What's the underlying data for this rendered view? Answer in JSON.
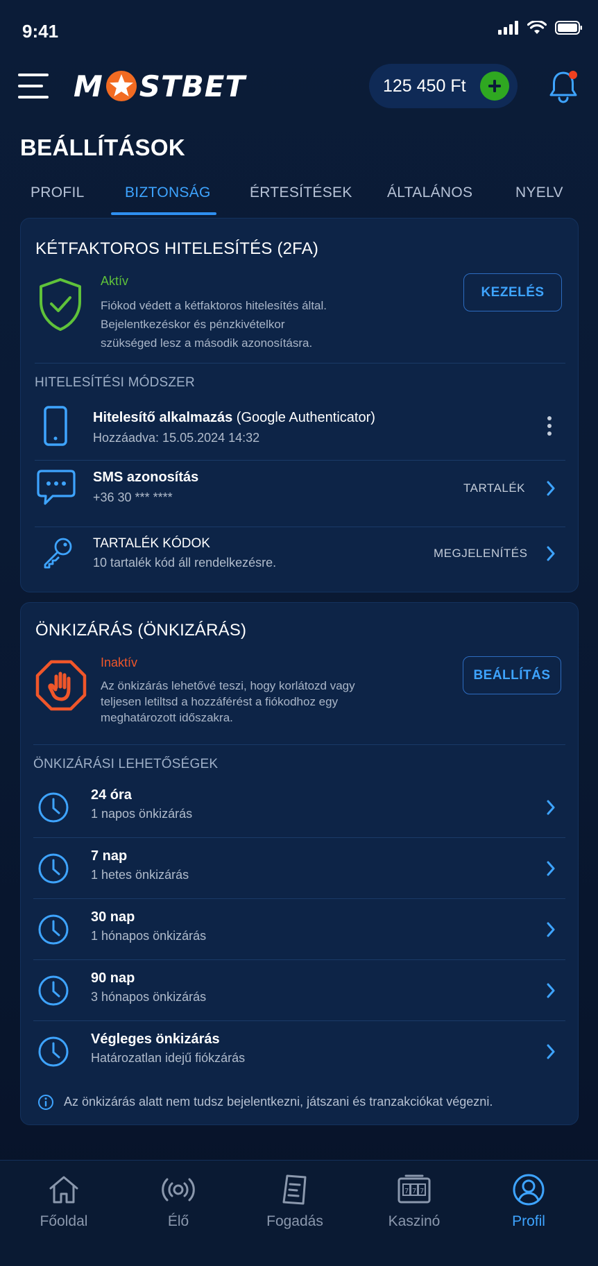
{
  "status_bar": {
    "time": "9:41"
  },
  "header": {
    "logo_left": "M",
    "logo_right": "STBET",
    "balance": "125 450 Ft"
  },
  "page": {
    "title": "BEÁLLÍTÁSOK"
  },
  "tabs": [
    {
      "label": "PROFIL",
      "active": false
    },
    {
      "label": "BIZTONSÁG",
      "active": true
    },
    {
      "label": "ÉRTESÍTÉSEK",
      "active": false
    },
    {
      "label": "ÁLTALÁNOS",
      "active": false
    },
    {
      "label": "NYELV",
      "active": false
    }
  ],
  "twofa": {
    "title": "KÉTFAKTOROS HITELESÍTÉS (2FA)",
    "status": "Aktív",
    "status_color": "#5fc23a",
    "desc_lines": [
      "Fiókod védett a kétfaktoros hitelesítés által.",
      "Bejelentkezéskor és pénzkivételkor",
      "szükséged lesz a második azonosításra."
    ],
    "button": "KEZELÉS",
    "methods_label": "HITELESÍTÉSI MÓDSZER",
    "methods": [
      {
        "icon": "smartphone-icon",
        "title_bold": "Hitelesítő alkalmazás",
        "title_rest": "(Google Authenticator)",
        "sub": "Hozzáadva: 15.05.2024 14:32",
        "action": ""
      },
      {
        "icon": "sms-icon",
        "title_bold": "SMS azonosítás",
        "title_rest": "",
        "sub": "+36 30 *** ****",
        "action": "TARTALÉK"
      },
      {
        "icon": "key-icon",
        "title_bold": "TARTALÉK KÓDOK",
        "title_rest": "",
        "sub": "10 tartalék kód áll rendelkezésre.",
        "action": "MEGJELENÍTÉS"
      }
    ]
  },
  "selfexclusion": {
    "title": "ÖNKIZÁRÁS (ÖNKIZÁRÁS)",
    "status": "Inaktív",
    "status_color": "#f0562a",
    "desc_lines": [
      "Az önkizárás lehetővé teszi, hogy korlátozd vagy",
      "teljesen letiltsd a hozzáférést a fiókodhoz egy",
      "meghatározott időszakra."
    ],
    "button": "BEÁLLÍTÁS",
    "options_label": "ÖNKIZÁRÁSI LEHETŐSÉGEK",
    "options": [
      {
        "title": "24 óra",
        "sub": "1 napos önkizárás"
      },
      {
        "title": "7 nap",
        "sub": "1 hetes önkizárás"
      },
      {
        "title": "30 nap",
        "sub": "1 hónapos önkizárás"
      },
      {
        "title": "90 nap",
        "sub": "3 hónapos önkizárás"
      },
      {
        "title": "Végleges önkizárás",
        "sub": "Határozatlan idejű fiókzárás"
      }
    ],
    "note": "Az önkizárás alatt nem tudsz bejelentkezni, játszani és tranzakciókat végezni."
  },
  "bottom_nav": [
    {
      "label": "Főoldal",
      "icon": "home-icon",
      "active": false
    },
    {
      "label": "Élő",
      "icon": "live-icon",
      "active": false
    },
    {
      "label": "Fogadás",
      "icon": "betslip-icon",
      "active": false
    },
    {
      "label": "Kaszinó",
      "icon": "slot-machine-icon",
      "active": false
    },
    {
      "label": "Profil",
      "icon": "profile-icon",
      "active": true
    }
  ],
  "colors": {
    "accent": "#3ea4ff",
    "active_green": "#5fc23a",
    "inactive_orange": "#f0562a",
    "add_green": "#2fa821",
    "notification_red": "#f0401f"
  }
}
